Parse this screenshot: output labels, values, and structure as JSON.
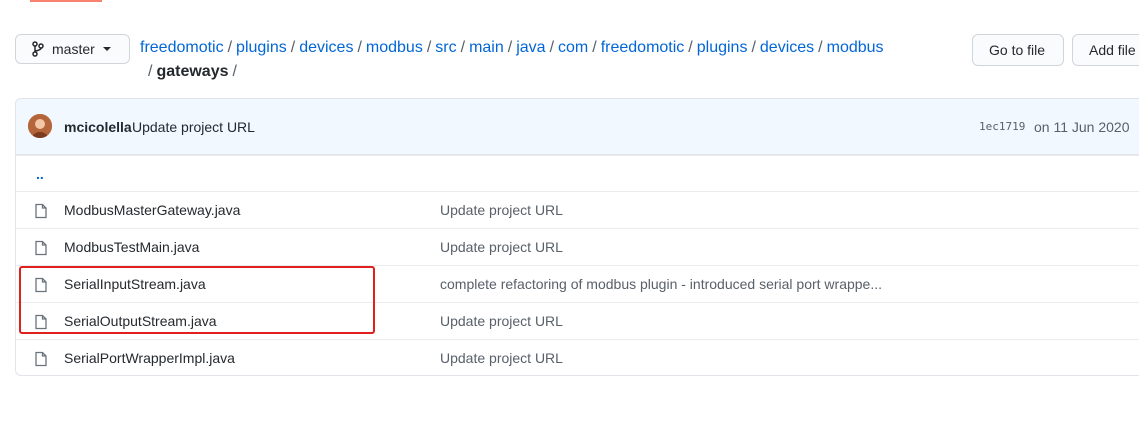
{
  "branch": {
    "label": "master"
  },
  "breadcrumb": {
    "segments": [
      "freedomotic",
      "plugins",
      "devices",
      "modbus",
      "src",
      "main",
      "java",
      "com",
      "freedomotic",
      "plugins",
      "devices",
      "modbus"
    ],
    "current": "gateways",
    "separator": "/"
  },
  "actions": {
    "goto_file": "Go to file",
    "add_file": "Add file"
  },
  "commit": {
    "author": "mcicolella",
    "message": "Update project URL",
    "sha": "1ec1719",
    "date": "on 11 Jun 2020"
  },
  "parent_dir": "..",
  "files": [
    {
      "name": "ModbusMasterGateway.java",
      "message": "Update project URL"
    },
    {
      "name": "ModbusTestMain.java",
      "message": "Update project URL"
    },
    {
      "name": "SerialInputStream.java",
      "message": "complete refactoring of modbus plugin - introduced serial port wrappe..."
    },
    {
      "name": "SerialOutputStream.java",
      "message": "Update project URL"
    },
    {
      "name": "SerialPortWrapperImpl.java",
      "message": "Update project URL"
    }
  ],
  "colors": {
    "link": "#0366d6",
    "highlight": "#e0201d",
    "commit_bar": "#f1f8ff"
  }
}
